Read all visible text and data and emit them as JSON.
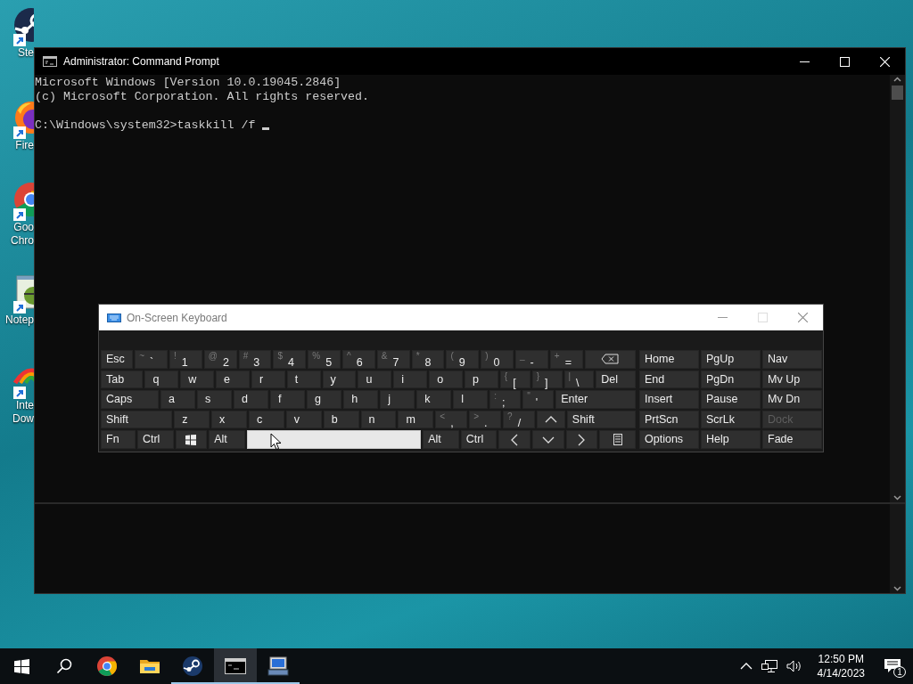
{
  "desktop_icons": [
    {
      "kind": "steam",
      "lines": [
        "Ste"
      ]
    },
    {
      "kind": "firefox",
      "lines": [
        "Fire"
      ]
    },
    {
      "kind": "chrome",
      "lines": [
        "Goo",
        "Chro"
      ]
    },
    {
      "kind": "notepad",
      "lines": [
        "Notep"
      ]
    },
    {
      "kind": "download",
      "lines": [
        "Inte",
        "Dow"
      ]
    }
  ],
  "cmd_window": {
    "title": "Administrator:  Command Prompt",
    "lines": [
      "Microsoft Windows [Version 10.0.19045.2846]",
      "(c) Microsoft Corporation. All rights reserved."
    ],
    "prompt": "C:\\Windows\\system32>taskkill /f "
  },
  "osk": {
    "title": "On-Screen Keyboard",
    "rows": [
      [
        {
          "label": "Esc",
          "pressed": false
        },
        {
          "label": "`",
          "shift": "~",
          "pressed": false
        },
        {
          "label": "1",
          "shift": "!",
          "pressed": false
        },
        {
          "label": "2",
          "shift": "@",
          "pressed": false
        },
        {
          "label": "3",
          "shift": "#",
          "pressed": false
        },
        {
          "label": "4",
          "shift": "$",
          "pressed": false
        },
        {
          "label": "5",
          "shift": "%",
          "pressed": false
        },
        {
          "label": "6",
          "shift": "^",
          "pressed": false
        },
        {
          "label": "7",
          "shift": "&",
          "pressed": false
        },
        {
          "label": "8",
          "shift": "*",
          "pressed": false
        },
        {
          "label": "9",
          "shift": "(",
          "pressed": false
        },
        {
          "label": "0",
          "shift": ")",
          "pressed": false
        },
        {
          "label": "-",
          "shift": "_",
          "pressed": false
        },
        {
          "label": "=",
          "shift": "+",
          "pressed": false
        },
        {
          "kind": "backspace",
          "pressed": false
        }
      ],
      [
        {
          "label": "Tab",
          "pressed": false
        },
        {
          "label": "q",
          "pressed": false
        },
        {
          "label": "w",
          "pressed": false
        },
        {
          "label": "e",
          "pressed": false
        },
        {
          "label": "r",
          "pressed": false
        },
        {
          "label": "t",
          "pressed": false
        },
        {
          "label": "y",
          "pressed": false
        },
        {
          "label": "u",
          "pressed": false
        },
        {
          "label": "i",
          "pressed": false
        },
        {
          "label": "o",
          "pressed": false
        },
        {
          "label": "p",
          "pressed": false
        },
        {
          "label": "[",
          "shift": "{",
          "pressed": false
        },
        {
          "label": "]",
          "shift": "}",
          "pressed": false
        },
        {
          "label": "\\",
          "shift": "|",
          "pressed": false
        },
        {
          "label": "Del",
          "pressed": false
        }
      ],
      [
        {
          "label": "Caps",
          "pressed": false
        },
        {
          "label": "a",
          "pressed": false
        },
        {
          "label": "s",
          "pressed": false
        },
        {
          "label": "d",
          "pressed": false
        },
        {
          "label": "f",
          "pressed": false
        },
        {
          "label": "g",
          "pressed": false
        },
        {
          "label": "h",
          "pressed": false
        },
        {
          "label": "j",
          "pressed": false
        },
        {
          "label": "k",
          "pressed": false
        },
        {
          "label": "l",
          "pressed": false
        },
        {
          "label": ";",
          "shift": ":",
          "pressed": false
        },
        {
          "label": "'",
          "shift": "\"",
          "pressed": false
        },
        {
          "label": "Enter",
          "pressed": false
        }
      ],
      [
        {
          "label": "Shift",
          "pressed": false
        },
        {
          "label": "z",
          "pressed": false
        },
        {
          "label": "x",
          "pressed": false
        },
        {
          "label": "c",
          "pressed": false
        },
        {
          "label": "v",
          "pressed": false
        },
        {
          "label": "b",
          "pressed": false
        },
        {
          "label": "n",
          "pressed": false
        },
        {
          "label": "m",
          "pressed": false
        },
        {
          "label": ",",
          "shift": "<",
          "pressed": false
        },
        {
          "label": ".",
          "shift": ">",
          "pressed": false
        },
        {
          "label": "/",
          "shift": "?",
          "pressed": false
        },
        {
          "kind": "up",
          "pressed": false
        },
        {
          "label": "Shift",
          "pressed": false
        }
      ],
      [
        {
          "label": "Fn",
          "pressed": false
        },
        {
          "label": "Ctrl",
          "pressed": false
        },
        {
          "kind": "windows",
          "pressed": false
        },
        {
          "label": "Alt",
          "pressed": false
        },
        {
          "kind": "space",
          "pressed": true
        },
        {
          "label": "Alt",
          "pressed": false
        },
        {
          "label": "Ctrl",
          "pressed": false
        },
        {
          "kind": "left",
          "pressed": false
        },
        {
          "kind": "down",
          "pressed": false
        },
        {
          "kind": "right",
          "pressed": false
        },
        {
          "kind": "menu",
          "pressed": false
        }
      ]
    ],
    "nav_keys": [
      {
        "label": "Home",
        "disabled": false
      },
      {
        "label": "PgUp",
        "disabled": false
      },
      {
        "label": "Nav",
        "disabled": false
      },
      {
        "label": "End",
        "disabled": false
      },
      {
        "label": "PgDn",
        "disabled": false
      },
      {
        "label": "Mv Up",
        "disabled": false
      },
      {
        "label": "Insert",
        "disabled": false
      },
      {
        "label": "Pause",
        "disabled": false
      },
      {
        "label": "Mv Dn",
        "disabled": false
      },
      {
        "label": "PrtScn",
        "disabled": false
      },
      {
        "label": "ScrLk",
        "disabled": false
      },
      {
        "label": "Dock",
        "disabled": true
      },
      {
        "label": "Options",
        "disabled": false
      },
      {
        "label": "Help",
        "disabled": false
      },
      {
        "label": "Fade",
        "disabled": false
      }
    ]
  },
  "taskbar": {
    "apps": [
      {
        "kind": "chrome",
        "running": false,
        "active": false
      },
      {
        "kind": "explorer",
        "running": false,
        "active": false
      },
      {
        "kind": "steam",
        "running": true,
        "active": false
      },
      {
        "kind": "cmd",
        "running": true,
        "active": true
      },
      {
        "kind": "osk",
        "running": true,
        "active": false
      }
    ],
    "time": "12:50 PM",
    "date": "4/14/2023",
    "notifications": "1"
  }
}
